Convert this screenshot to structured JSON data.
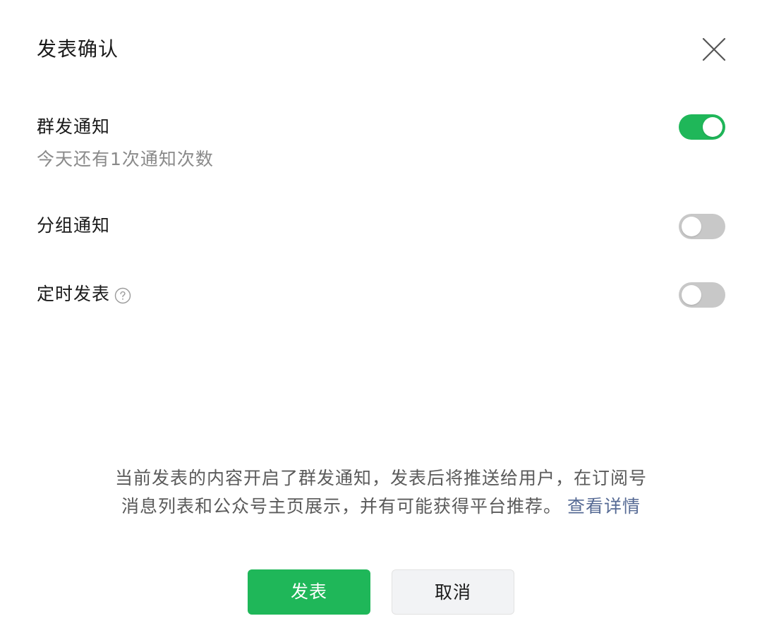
{
  "dialog": {
    "title": "发表确认",
    "close_icon": "close-icon"
  },
  "options": [
    {
      "label": "群发通知",
      "description": "今天还有1次通知次数",
      "enabled": true
    },
    {
      "label": "分组通知",
      "enabled": false
    },
    {
      "label": "定时发表",
      "help_icon": "question-circle-icon",
      "enabled": false
    }
  ],
  "notice": {
    "line1": "当前发表的内容开启了群发通知，发表后将推送给用户，在订阅号",
    "line2": "消息列表和公众号主页展示，并有可能获得平台推荐。",
    "link": "查看详情"
  },
  "buttons": {
    "publish_label": "发表",
    "cancel_label": "取消"
  },
  "colors": {
    "accent": "#1fb759",
    "toggle_off": "#c8c8c8",
    "link": "#576b95"
  }
}
